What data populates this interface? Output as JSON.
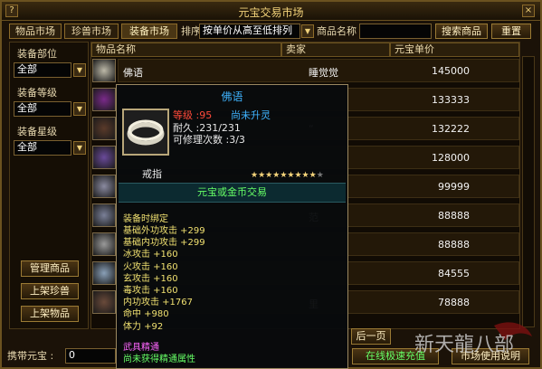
{
  "window": {
    "title": "元宝交易市场",
    "help_icon": "?",
    "close_icon": "×"
  },
  "tabs": [
    "物品市场",
    "珍兽市场",
    "装备市场"
  ],
  "sort": {
    "label": "排序",
    "value": "按单价从高至低排列"
  },
  "search": {
    "label": "商品名称",
    "value": "",
    "button": "搜索商品",
    "reset": "重置"
  },
  "filters": {
    "part": {
      "label": "装备部位",
      "value": "全部"
    },
    "level": {
      "label": "装备等级",
      "value": "全部"
    },
    "star": {
      "label": "装备星级",
      "value": "全部"
    }
  },
  "side_buttons": {
    "manage": "管理商品",
    "list_pet": "上架珍兽",
    "list_item": "上架物品"
  },
  "table": {
    "headers": {
      "name": "物品名称",
      "seller": "卖家",
      "price": "元宝单价"
    },
    "rows": [
      {
        "name": "佛语",
        "seller": "睡觉觉",
        "price": "145000"
      },
      {
        "name": "",
        "seller": "",
        "price": "133333"
      },
      {
        "name": "",
        "seller": "“",
        "price": "132222"
      },
      {
        "name": "",
        "seller": "",
        "price": "128000"
      },
      {
        "name": "",
        "seller": "",
        "price": "99999"
      },
      {
        "name": "",
        "seller": "范",
        "price": "88888"
      },
      {
        "name": "",
        "seller": "",
        "price": "88888"
      },
      {
        "name": "",
        "seller": "",
        "price": "84555"
      },
      {
        "name": "",
        "seller": "里",
        "price": "78888"
      }
    ]
  },
  "tooltip": {
    "title": "佛语",
    "level": "等级 :95",
    "ascend": "尚未升灵",
    "durability": "耐久 :231/231",
    "repair": "可修理次数 :3/3",
    "type": "戒指",
    "trade": "元宝或金币交易",
    "bind": "装备时绑定",
    "attrs": [
      "基础外功攻击 +299",
      "基础内功攻击 +299",
      "冰攻击 +160",
      "火攻击 +160",
      "玄攻击 +160",
      "毒攻击 +160",
      "内功攻击 +1767",
      "命中 +980",
      "体力 +92"
    ],
    "weapon_precise": "武具精通",
    "unrefined": "尚未获得精通属性",
    "stars_filled": 9,
    "stars_total": 10
  },
  "footer": {
    "carry_label": "携带元宝 :",
    "carry_value": "0",
    "next_page": "后一页",
    "recharge": "在线极速充值",
    "help": "市场使用说明"
  },
  "logo": {
    "text": "新天龍八部"
  },
  "colors": {
    "gold": "#f3d37a",
    "tooltip_title": "#3fb4ff",
    "level_red": "#ff4a3a",
    "green": "#66ff66",
    "pink": "#ff66ff",
    "yellow_attr": "#f0e070"
  }
}
